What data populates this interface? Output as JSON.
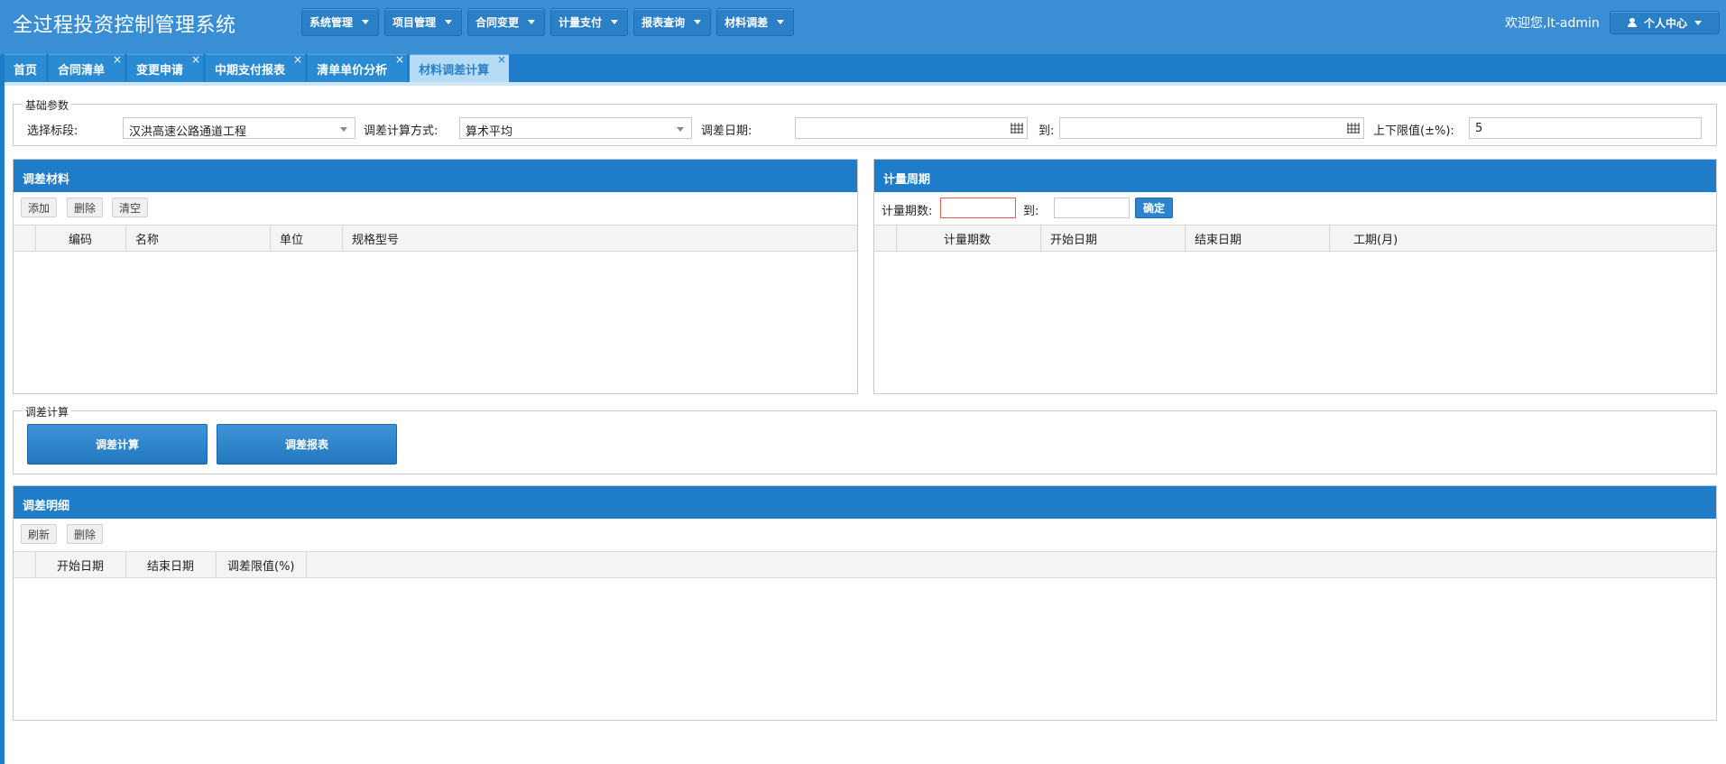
{
  "header": {
    "title": "全过程投资控制管理系统",
    "menus": [
      "系统管理",
      "项目管理",
      "合同变更",
      "计量支付",
      "报表查询",
      "材料调差"
    ],
    "welcome": "欢迎您,lt-admin",
    "user_center": "个人中心"
  },
  "tabs": [
    {
      "label": "首页",
      "closable": false
    },
    {
      "label": "合同清单",
      "closable": true
    },
    {
      "label": "变更申请",
      "closable": true
    },
    {
      "label": "中期支付报表",
      "closable": true
    },
    {
      "label": "清单单价分析",
      "closable": true
    },
    {
      "label": "材料调差计算",
      "closable": true,
      "active": true
    }
  ],
  "base_params": {
    "legend": "基础参数",
    "section_label": "选择标段:",
    "section_value": "汉洪高速公路通道工程",
    "method_label": "调差计算方式:",
    "method_value": "算术平均",
    "date_label": "调差日期:",
    "to_label": "到:",
    "limit_label": "上下限值(±%):",
    "limit_value": "5"
  },
  "materials_panel": {
    "title": "调差材料",
    "buttons": [
      "添加",
      "删除",
      "清空"
    ],
    "columns": [
      "编码",
      "名称",
      "单位",
      "规格型号"
    ]
  },
  "period_panel": {
    "title": "计量周期",
    "count_label": "计量期数:",
    "to_label": "到:",
    "confirm": "确定",
    "columns": [
      "计量期数",
      "开始日期",
      "结束日期",
      "工期(月)"
    ]
  },
  "calc": {
    "legend": "调差计算",
    "calc_button": "调差计算",
    "report_button": "调差报表"
  },
  "detail_panel": {
    "title": "调差明细",
    "buttons": [
      "刷新",
      "删除"
    ],
    "columns": [
      "开始日期",
      "结束日期",
      "调差限值(%)"
    ]
  },
  "colors": {
    "header_bg": "#3a8fd4",
    "tabbar_bg": "#1e7cc8",
    "active_tab_bg": "#b6dcf5",
    "panel_head_bg": "#1e7cc8"
  }
}
